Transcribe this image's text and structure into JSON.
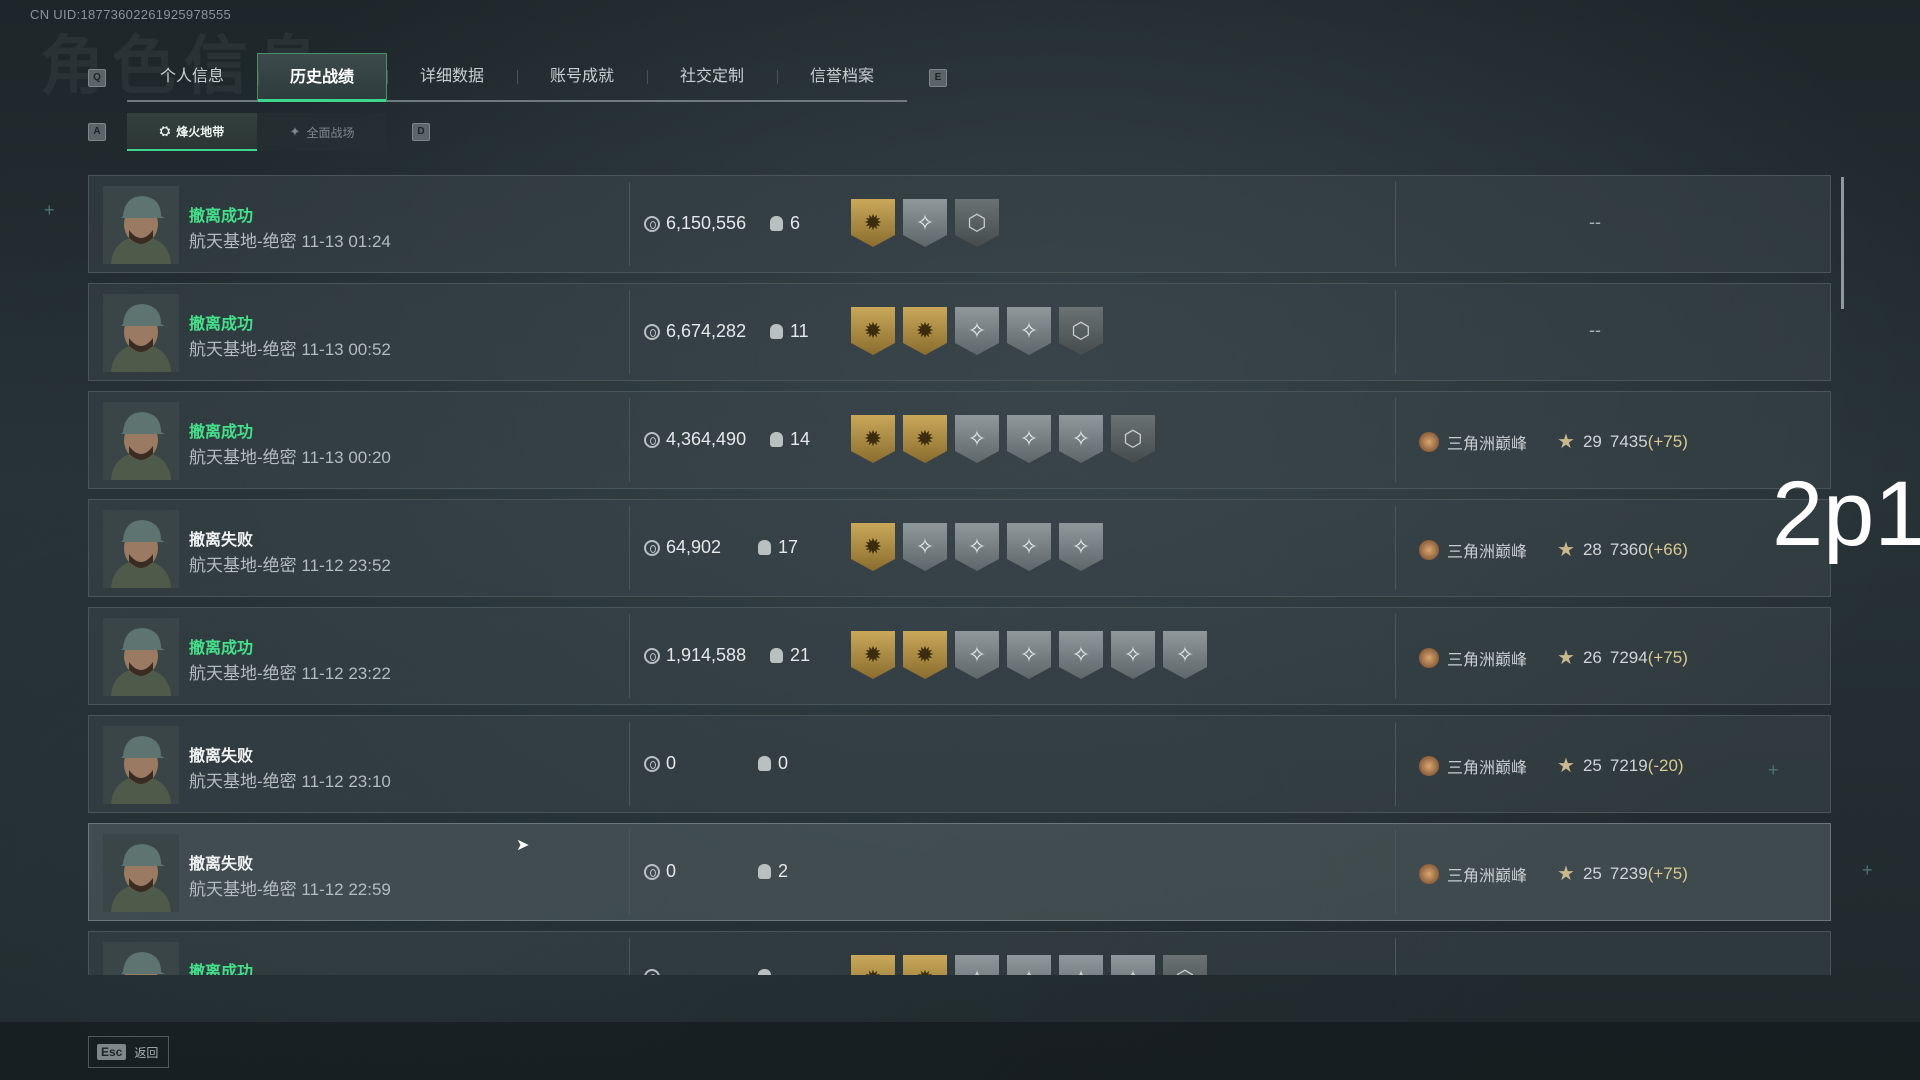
{
  "header": {
    "uid": "CN UID:18773602261925978555",
    "ghost_title": "角色信息"
  },
  "keys": {
    "q": "Q",
    "e": "E",
    "a": "A",
    "d": "D"
  },
  "tabs": [
    {
      "label": "个人信息"
    },
    {
      "label": "历史战绩",
      "active": true
    },
    {
      "label": "详细数据"
    },
    {
      "label": "账号成就"
    },
    {
      "label": "社交定制"
    },
    {
      "label": "信誉档案"
    }
  ],
  "subtabs": [
    {
      "label": "烽火地带",
      "active": true
    },
    {
      "label": "全面战场"
    }
  ],
  "matches": [
    {
      "result": "撤离成功",
      "success": true,
      "map": "航天基地-绝密",
      "time": "11-13 01:24",
      "value": "6,150,556",
      "kills": "6",
      "badges": [
        "gold",
        "silver",
        "dark"
      ],
      "rank": null,
      "dash": "--"
    },
    {
      "result": "撤离成功",
      "success": true,
      "map": "航天基地-绝密",
      "time": "11-13 00:52",
      "value": "6,674,282",
      "kills": "11",
      "badges": [
        "gold",
        "gold",
        "silver",
        "silver",
        "dark"
      ],
      "rank": null,
      "dash": "--"
    },
    {
      "result": "撤离成功",
      "success": true,
      "map": "航天基地-绝密",
      "time": "11-13 00:20",
      "value": "4,364,490",
      "kills": "14",
      "badges": [
        "gold",
        "gold",
        "silver",
        "silver",
        "silver",
        "dark"
      ],
      "rank": {
        "name": "三角洲巅峰",
        "stars": "29",
        "score": "7435",
        "delta": "(+75)"
      }
    },
    {
      "result": "撤离失败",
      "success": false,
      "map": "航天基地-绝密",
      "time": "11-12 23:52",
      "value": "64,902",
      "kills": "17",
      "badges": [
        "gold",
        "silver",
        "silver",
        "silver",
        "silver"
      ],
      "rank": {
        "name": "三角洲巅峰",
        "stars": "28",
        "score": "7360",
        "delta": "(+66)"
      }
    },
    {
      "result": "撤离成功",
      "success": true,
      "map": "航天基地-绝密",
      "time": "11-12 23:22",
      "value": "1,914,588",
      "kills": "21",
      "badges": [
        "gold",
        "gold",
        "silver",
        "silver",
        "silver",
        "silver",
        "silver"
      ],
      "rank": {
        "name": "三角洲巅峰",
        "stars": "26",
        "score": "7294",
        "delta": "(+75)"
      }
    },
    {
      "result": "撤离失败",
      "success": false,
      "map": "航天基地-绝密",
      "time": "11-12 23:10",
      "value": "0",
      "kills": "0",
      "badges": [],
      "rank": {
        "name": "三角洲巅峰",
        "stars": "25",
        "score": "7219",
        "delta": "(-20)"
      }
    },
    {
      "result": "撤离失败",
      "success": false,
      "map": "航天基地-绝密",
      "time": "11-12 22:59",
      "value": "0",
      "kills": "2",
      "badges": [],
      "rank": {
        "name": "三角洲巅峰",
        "stars": "25",
        "score": "7239",
        "delta": "(+75)"
      }
    },
    {
      "result": "撤离成功",
      "success": true,
      "map": "",
      "time": "",
      "value": "",
      "kills": "",
      "badges": [
        "gold",
        "gold",
        "silver",
        "silver",
        "silver",
        "silver",
        "dark"
      ],
      "rank": null,
      "dash": ""
    }
  ],
  "overlay_text": "2p1",
  "footer": {
    "esc_key": "Esc",
    "esc_label": "返回"
  },
  "colors": {
    "accent": "#3dd68c",
    "success": "#45e08a",
    "gold": "#c9a85a"
  },
  "icons": {
    "coin": "coin-icon",
    "kills": "skull-icon",
    "rank": "rank-emblem-icon",
    "star": "star-icon"
  }
}
